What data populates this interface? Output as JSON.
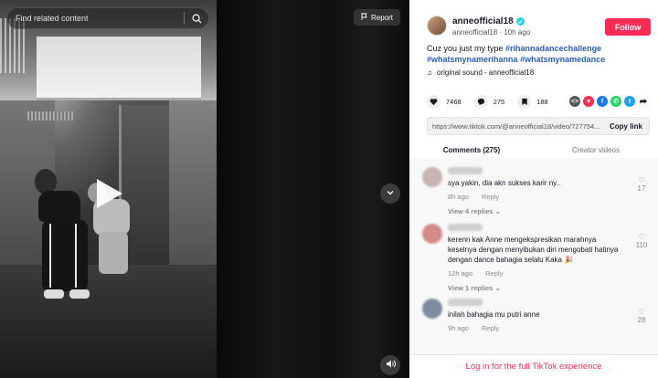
{
  "video": {
    "search_placeholder": "Find related content",
    "report_label": "Report"
  },
  "author": {
    "username": "anneofficial18",
    "meta": "anneofficial18 · 10h ago",
    "follow_label": "Follow"
  },
  "caption": {
    "text": "Cuz you just my type ",
    "hashtags": [
      "#rihannadancechallenge",
      "#whatsmynamerihanna",
      "#whatsmynamedance"
    ]
  },
  "sound": {
    "label": "original sound - anneofficial18"
  },
  "stats": {
    "likes": "7468",
    "comments": "275",
    "saves": "188"
  },
  "share": {
    "url": "https://www.tiktok.com/@anneofficial18/video/727754...",
    "copy_label": "Copy link"
  },
  "tabs": [
    {
      "label": "Comments (275)",
      "active": true
    },
    {
      "label": "Creator videos",
      "active": false
    }
  ],
  "comments": [
    {
      "text": "sya yakin, dia akn sukses karir ny..",
      "time": "8h ago",
      "reply_label": "Reply",
      "likes": "17",
      "replies_label": "View 4 replies",
      "avatar_color": "#c8b4b4"
    },
    {
      "text": "kerenn kak Anne mengekspresikan marahnya keselnya dengan menyibukan diri mengobati hatinya dengan dance bahagia selalu Kaka 🎉",
      "time": "12h ago",
      "reply_label": "Reply",
      "likes": "110",
      "replies_label": "View 1 replies",
      "avatar_color": "#d48a8a"
    },
    {
      "text": "inilah bahagia mu putri anne",
      "time": "9h ago",
      "reply_label": "Reply",
      "likes": "28",
      "replies_label": "",
      "avatar_color": "#7d8ca0"
    }
  ],
  "login_prompt": "Log in for the full TikTok experience",
  "colors": {
    "accent": "#fe2c55",
    "hashtag": "#2b5db9",
    "verified": "#20d5ec"
  }
}
